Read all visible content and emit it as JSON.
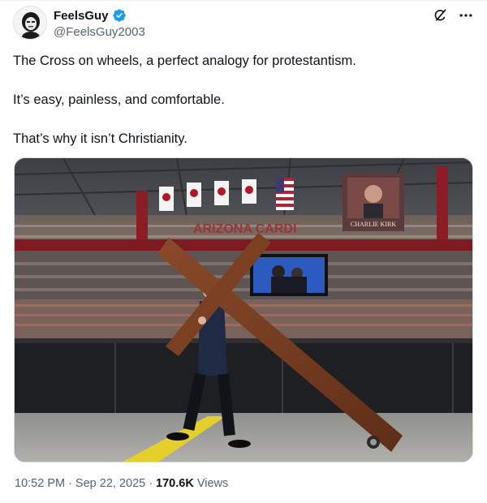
{
  "author": {
    "display_name": "FeelsGuy",
    "handle": "@FeelsGuy2003",
    "verified": true
  },
  "icons": {
    "verified": "verified-badge-icon",
    "grok": "grok-icon",
    "more": "more-options-icon"
  },
  "post": {
    "paragraphs": [
      "The Cross on wheels, a perfect analogy for protestantism.",
      "It’s easy, painless, and comfortable.",
      "That’s why it isn’t Christianity."
    ],
    "image": {
      "banner_name": "CHARLIE KIRK",
      "arena_sign_partial": "ARIZONA CARDI"
    }
  },
  "meta": {
    "time": "10:52 PM",
    "date": "Sep 22, 2025",
    "views_count": "170.6K",
    "views_label": "Views"
  },
  "colors": {
    "accent_blue": "#1d9bf0",
    "text_primary": "#0f1419",
    "text_secondary": "#536471"
  }
}
